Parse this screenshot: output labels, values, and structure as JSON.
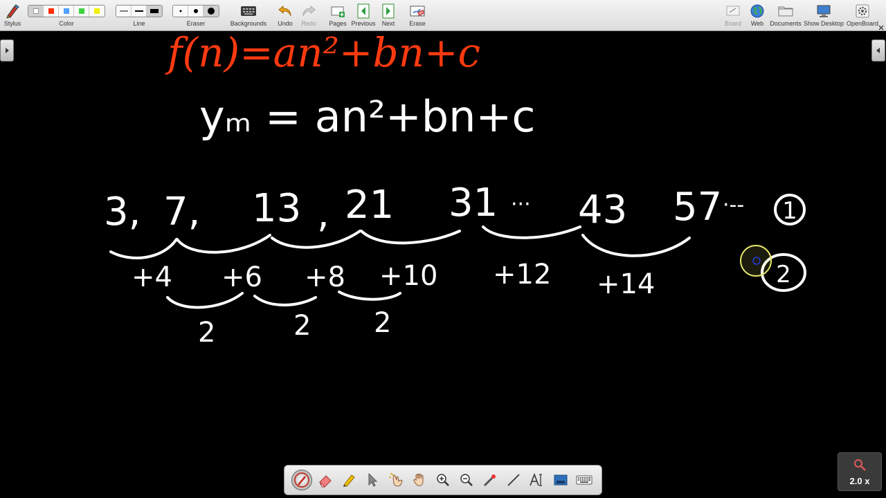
{
  "toolbar": {
    "stylus": "Stylus",
    "color": "Color",
    "line": "Line",
    "eraser": "Eraser",
    "backgrounds": "Backgrounds",
    "undo": "Undo",
    "redo": "Redo",
    "pages": "Pages",
    "previous": "Previous",
    "next": "Next",
    "erase": "Erase",
    "board": "Board",
    "web": "Web",
    "documents": "Documents",
    "show_desktop": "Show Desktop",
    "openboard": "OpenBoard"
  },
  "colors": {
    "palette": [
      "#ffffff",
      "#ff2a00",
      "#4fa0ff",
      "#3ed43e",
      "#f2f200"
    ],
    "ink_red": "#ff3a10",
    "ink_white": "#ffffff",
    "pointer_ring": "#e8e86a",
    "pointer_dot": "#2a3ae0"
  },
  "board": {
    "formula_red": "f(n)=an²+bn+c",
    "formula_white": "yₘ = an²+bn+c",
    "sequence": [
      "3,",
      "7,",
      "13",
      ",",
      "21",
      "31",
      "···",
      "43",
      "57",
      "·--"
    ],
    "first_differences": [
      "+4",
      "+6",
      "+8",
      "+10",
      "+12",
      "+14"
    ],
    "second_differences": [
      "2",
      "2",
      "2"
    ],
    "circled_labels": [
      "1",
      "2"
    ]
  },
  "zoom": {
    "value": "2.0 x"
  }
}
